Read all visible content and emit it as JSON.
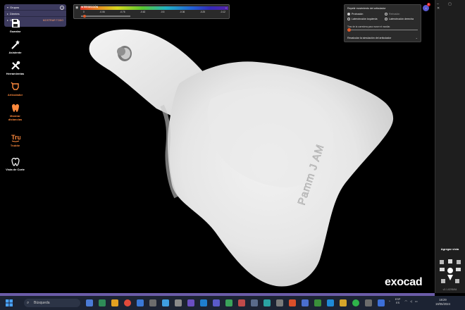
{
  "group_panel": {
    "rows": [
      {
        "label": "Grupos",
        "action": ""
      },
      {
        "label": "Dientes",
        "action": ""
      },
      {
        "label": "Oculto",
        "action": "MOSTRAR TODO"
      }
    ],
    "help": "?"
  },
  "color_scale": {
    "title": "INTERSECCIÓN",
    "ticks": [
      "0",
      "-0.06",
      "-0.76",
      "-0.62",
      "-0.5",
      "-0.36",
      "-0.25",
      "-0.12"
    ],
    "collapse": "⌄"
  },
  "articulator": {
    "title": "Repetir movimiento del articulador",
    "options": [
      {
        "label": "Protrusión",
        "selected": true
      },
      {
        "label": "Retrusión",
        "selected": false
      },
      {
        "label": "Laterotrusión izquierda",
        "selected": false
      },
      {
        "label": "Laterotrusión derecha",
        "selected": false
      }
    ],
    "hint": "Tirar de la corredera para mover el maxilar.",
    "recalc": "Recalcular la simulación del articulador"
  },
  "notifications": {
    "count": "9"
  },
  "model": {
    "engraving": "Pamm J AM"
  },
  "toolbar": {
    "items": [
      {
        "label": "Guardar",
        "icon": "save-icon",
        "orange": false
      },
      {
        "label": "Asistente",
        "icon": "wand-icon",
        "orange": false
      },
      {
        "label": "Herramientas",
        "icon": "tools-icon",
        "orange": false
      },
      {
        "label": "Articulador",
        "icon": "articulator-icon",
        "orange": true
      },
      {
        "label": "Mostrar distancias",
        "icon": "distance-icon",
        "orange": true
      },
      {
        "label": "Trubite",
        "icon": "trubite-icon",
        "orange": true
      },
      {
        "label": "Vista de Corte",
        "icon": "cut-view-icon",
        "orange": false
      }
    ],
    "add_view": "Agregar vista",
    "version": "v3.1-8298/64"
  },
  "brand": "exocad",
  "taskbar": {
    "search_placeholder": "Búsqueda",
    "tray_lang": "ESP",
    "tray_region": "ES",
    "time": "18:29",
    "date": "19/05/2024"
  },
  "colors": {
    "accent": "#ff8a3d",
    "panel": "#3c3a5e",
    "taskbar": "#1c2333",
    "strip": "#6b5ca8"
  }
}
